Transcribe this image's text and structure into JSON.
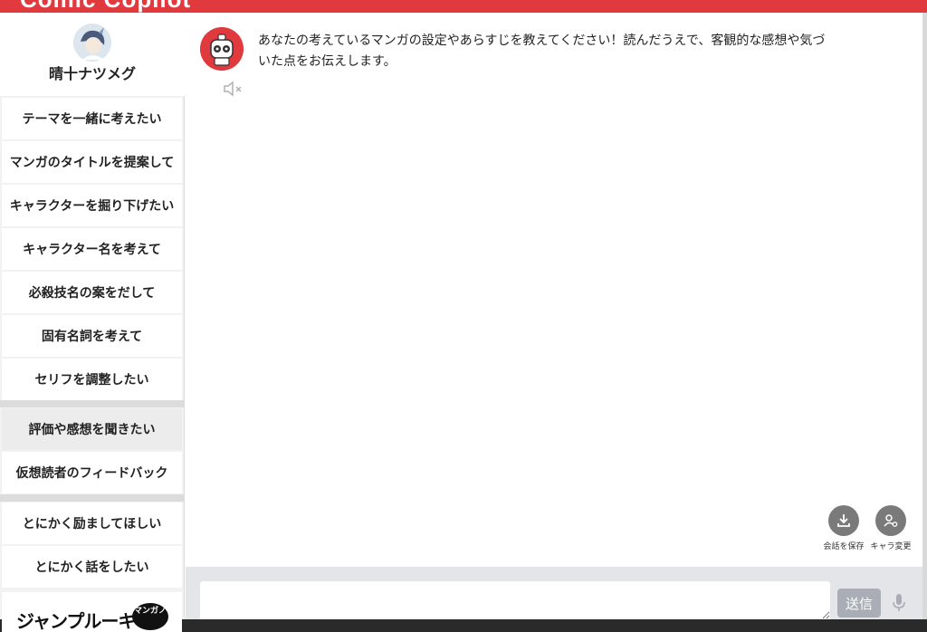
{
  "header": {
    "title": "Comic Copilot"
  },
  "profile": {
    "name": "晴十ナツメグ",
    "avatar_icon": "user-avatar"
  },
  "menu": {
    "groups": [
      [
        {
          "label": "テーマを一緒に考えたい"
        },
        {
          "label": "マンガのタイトルを提案して"
        },
        {
          "label": "キャラクターを掘り下げたい"
        },
        {
          "label": "キャラクター名を考えて"
        },
        {
          "label": "必殺技名の案をだして"
        },
        {
          "label": "固有名詞を考えて"
        },
        {
          "label": "セリフを調整したい"
        }
      ],
      [
        {
          "label": "評価や感想を聞きたい",
          "selected": true
        },
        {
          "label": "仮想読者のフィードバック"
        }
      ],
      [
        {
          "label": "とにかく励ましてほしい"
        },
        {
          "label": "とにかく話をしたい"
        }
      ]
    ]
  },
  "promo": {
    "text": "ジャンプルーキー!",
    "badge": "マンガノ"
  },
  "chat": {
    "bot_icon": "robot-avatar",
    "message": "あなたの考えているマンガの設定やあらすじを教えてください！読んだうえで、客観的な感想や気づいた点をお伝えします。",
    "mute_icon": "speaker-muted-icon"
  },
  "actions": {
    "save_label": "会話を保存",
    "change_label": "キャラ変更"
  },
  "composer": {
    "placeholder": "",
    "send_label": "送信"
  },
  "colors": {
    "accent": "#e03a3e",
    "sidebar_bg": "#f2f2f2",
    "send_disabled": "#a9aeb6"
  }
}
